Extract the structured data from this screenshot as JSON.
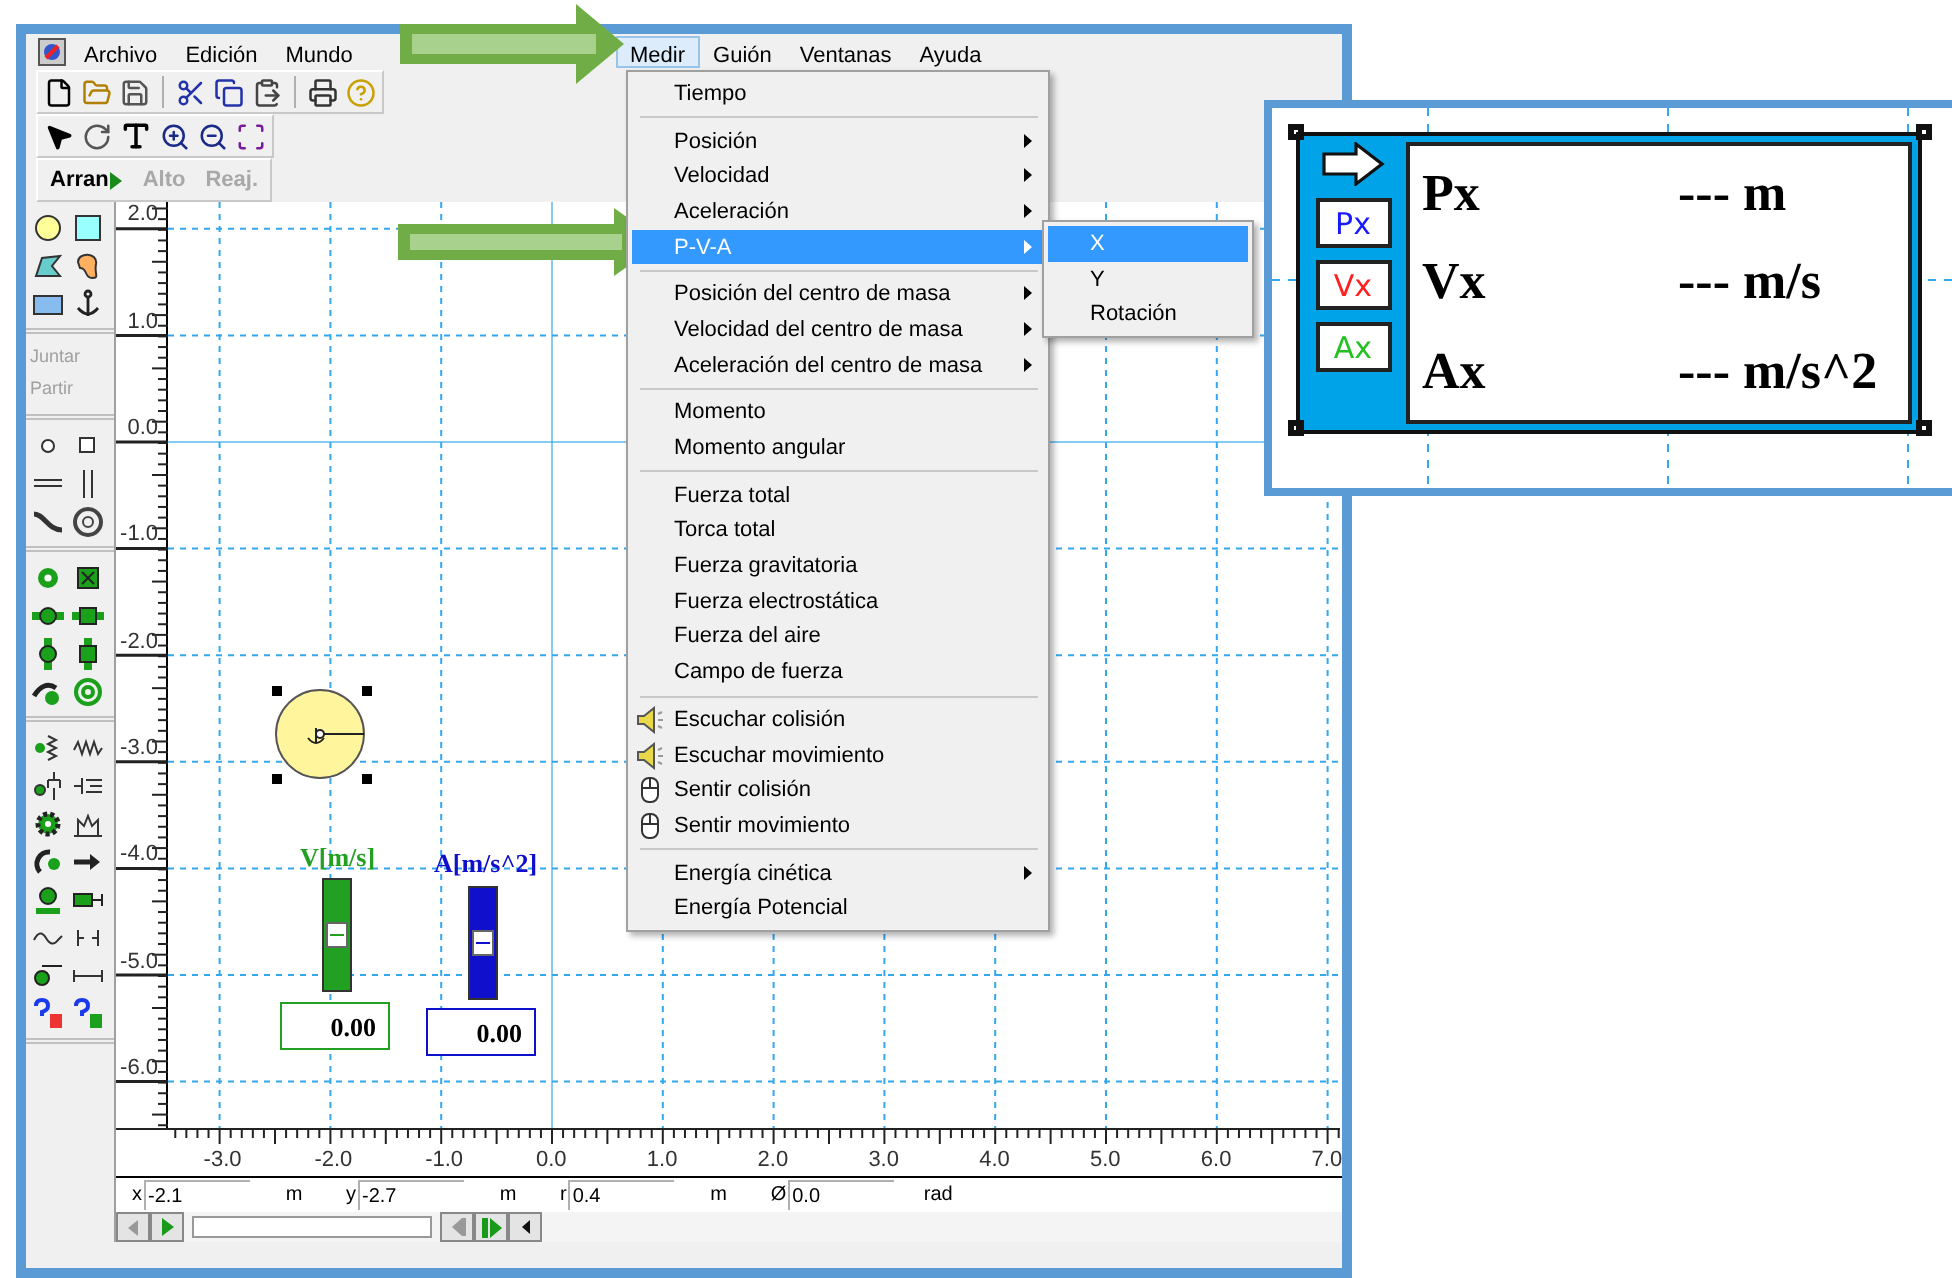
{
  "menubar": {
    "left": [
      {
        "label": "Archivo",
        "selected": false
      },
      {
        "label": "Edición",
        "selected": false
      },
      {
        "label": "Mundo",
        "selected": false
      }
    ],
    "right": [
      {
        "label": "Medir",
        "selected": true
      },
      {
        "label": "Guión",
        "selected": false
      },
      {
        "label": "Ventanas",
        "selected": false
      },
      {
        "label": "Ayuda",
        "selected": false
      }
    ]
  },
  "run_controls": [
    {
      "label": "Arran",
      "disabled": false
    },
    {
      "label": "Alto",
      "disabled": true
    },
    {
      "label": "Reaj.",
      "disabled": true
    }
  ],
  "palette_buttons": [
    {
      "label": "Juntar",
      "disabled": true
    },
    {
      "label": "Partir",
      "disabled": true
    }
  ],
  "y_ruler": [
    "2.0",
    "1.0",
    "0.0",
    "-1.0",
    "-2.0",
    "-3.0",
    "-4.0",
    "-5.0",
    "-6.0"
  ],
  "x_ruler": [
    "-3.0",
    "-2.0",
    "-1.0",
    "0.0",
    "1.0",
    "2.0",
    "3.0",
    "4.0",
    "5.0",
    "6.0",
    "7.0"
  ],
  "meters": [
    {
      "label": "V[m/s]",
      "color": "#22a022",
      "level": 0.5,
      "value": "0.00"
    },
    {
      "label": "A[m/s^2]",
      "color": "#1010cc",
      "level": 0.5,
      "value": "0.00"
    }
  ],
  "coordinates": [
    {
      "label": "x",
      "value": "-2.1",
      "unit": "m"
    },
    {
      "label": "y",
      "value": "-2.7",
      "unit": "m"
    },
    {
      "label": "r",
      "value": "0.4",
      "unit": "m"
    },
    {
      "label": "Ø",
      "value": "0.0",
      "unit": "rad"
    }
  ],
  "medir_menu": {
    "sections": [
      {
        "items": [
          {
            "label": "Tiempo",
            "kind": "plain",
            "selected": false
          }
        ]
      },
      {
        "items": [
          {
            "label": "Posición",
            "kind": "submenu",
            "selected": false
          },
          {
            "label": "Velocidad",
            "kind": "submenu",
            "selected": false
          },
          {
            "label": "Aceleración",
            "kind": "submenu",
            "selected": false
          },
          {
            "label": "P-V-A",
            "kind": "submenu",
            "selected": true
          }
        ]
      },
      {
        "items": [
          {
            "label": "Posición del centro de masa",
            "kind": "submenu",
            "selected": false
          },
          {
            "label": "Velocidad del centro de masa",
            "kind": "submenu",
            "selected": false
          },
          {
            "label": "Aceleración del centro de masa",
            "kind": "submenu",
            "selected": false
          }
        ]
      },
      {
        "items": [
          {
            "label": "Momento",
            "kind": "plain",
            "selected": false
          },
          {
            "label": "Momento angular",
            "kind": "plain",
            "selected": false
          }
        ]
      },
      {
        "items": [
          {
            "label": "Fuerza total",
            "kind": "plain",
            "selected": false
          },
          {
            "label": "Torca total",
            "kind": "plain",
            "selected": false
          },
          {
            "label": "Fuerza gravitatoria",
            "kind": "plain",
            "selected": false
          },
          {
            "label": "Fuerza electrostática",
            "kind": "plain",
            "selected": false
          },
          {
            "label": "Fuerza del aire",
            "kind": "plain",
            "selected": false
          },
          {
            "label": "Campo de fuerza",
            "kind": "plain",
            "selected": false
          }
        ]
      },
      {
        "items": [
          {
            "label": "Escuchar colisión",
            "kind": "sound",
            "selected": false
          },
          {
            "label": "Escuchar movimiento",
            "kind": "sound",
            "selected": false
          },
          {
            "label": "Sentir colisión",
            "kind": "touch",
            "selected": false
          },
          {
            "label": "Sentir movimiento",
            "kind": "touch",
            "selected": false
          }
        ]
      },
      {
        "items": [
          {
            "label": "Energía cinética",
            "kind": "submenu",
            "selected": false
          },
          {
            "label": "Energía Potencial",
            "kind": "plain",
            "selected": false
          }
        ]
      }
    ]
  },
  "pva_submenu": [
    {
      "label": "X",
      "selected": true
    },
    {
      "label": "Y",
      "selected": false
    },
    {
      "label": "Rotación",
      "selected": false
    }
  ],
  "inset_meter": {
    "buttons": [
      {
        "label": "Px",
        "color": "#1a1aff"
      },
      {
        "label": "Vx",
        "color": "#ff2020"
      },
      {
        "label": "Ax",
        "color": "#22c022"
      }
    ],
    "rows": [
      {
        "name": "Px",
        "value": "--- m"
      },
      {
        "name": "Vx",
        "value": "--- m/s"
      },
      {
        "name": "Ax",
        "value": "--- m/s^2"
      }
    ]
  }
}
